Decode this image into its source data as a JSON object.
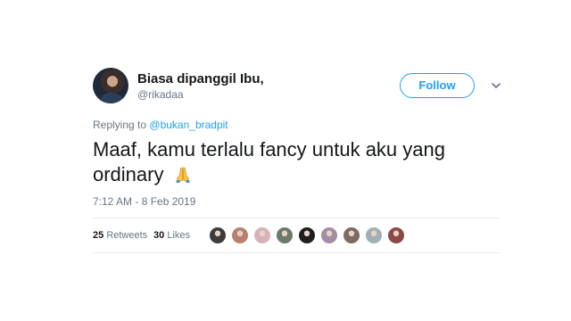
{
  "tweet": {
    "display_name": "Biasa dipanggil Ibu,",
    "handle": "@rikadaa",
    "follow_label": "Follow",
    "replying_prefix": "Replying to",
    "replying_to": "@bukan_bradpit",
    "text": "Maaf, kamu terlalu fancy untuk aku yang ordinary",
    "emoji_icon": "folded-hands-emoji",
    "timestamp": "7:12 AM - 8 Feb 2019",
    "retweets_count": "25",
    "retweets_label": "Retweets",
    "likes_count": "30",
    "likes_label": "Likes"
  },
  "liker_avatars": [
    {
      "color": "#3c3c3c"
    },
    {
      "color": "#b98072"
    },
    {
      "color": "#d7b3b9"
    },
    {
      "color": "#6b7a6a"
    },
    {
      "color": "#1f1f1f"
    },
    {
      "color": "#a48ea6"
    },
    {
      "color": "#7d6a62"
    },
    {
      "color": "#9fb1b6"
    },
    {
      "color": "#8a4a48"
    }
  ],
  "colors": {
    "accent": "#1da1f2",
    "muted": "#657786",
    "text": "#14171a",
    "divider": "#e6ecf0"
  }
}
